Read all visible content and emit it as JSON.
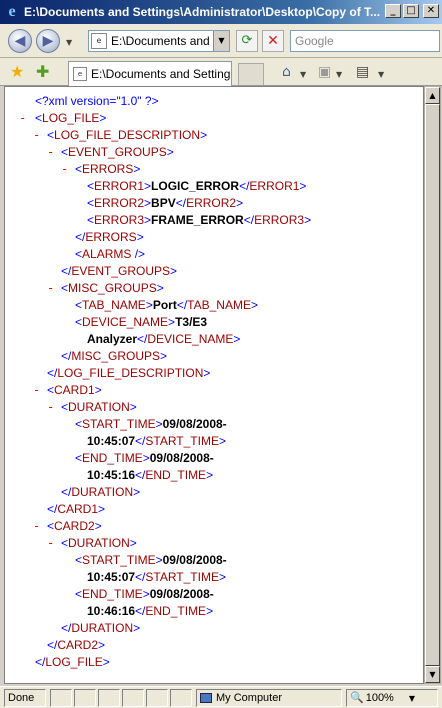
{
  "window": {
    "title": "E:\\Documents and Settings\\Administrator\\Desktop\\Copy of T...",
    "minimize_glyph": "_",
    "maximize_glyph": "□",
    "close_glyph": "✕"
  },
  "address_bar": {
    "url": "E:\\Documents and Set",
    "search_placeholder": "Google",
    "back_glyph": "◀",
    "forward_glyph": "▶",
    "refresh_glyph": "⟳",
    "stop_glyph": "✕"
  },
  "tabs": [
    {
      "label": "E:\\Documents and Setting..."
    }
  ],
  "toolbar": {
    "favorites_glyph": "★",
    "add_favorite_glyph": "✚",
    "home_glyph": "⌂",
    "feeds_glyph": "▣",
    "print_glyph": "▤"
  },
  "xml": {
    "declaration": "<?xml version=\"1.0\" ?>",
    "log_file": "LOG_FILE",
    "log_file_description": "LOG_FILE_DESCRIPTION",
    "event_groups": "EVENT_GROUPS",
    "errors": "ERRORS",
    "error1_tag": "ERROR1",
    "error1_val": "LOGIC_ERROR",
    "error2_tag": "ERROR2",
    "error2_val": "BPV",
    "error3_tag": "ERROR3",
    "error3_val": "FRAME_ERROR",
    "alarms": "ALARMS",
    "misc_groups": "MISC_GROUPS",
    "tab_name_tag": "TAB_NAME",
    "tab_name_val": "Port",
    "device_name_tag": "DEVICE_NAME",
    "device_name_val_1": "T3/E3",
    "device_name_val_2": "Analyzer",
    "card1": "CARD1",
    "card2": "CARD2",
    "duration": "DURATION",
    "start_time_tag": "START_TIME",
    "end_time_tag": "END_TIME",
    "card1_start_date": "09/08/2008-",
    "card1_start_time": "10:45:07",
    "card1_end_date": "09/08/2008-",
    "card1_end_time": "10:45:16",
    "card2_start_date": "09/08/2008-",
    "card2_start_time": "10:45:07",
    "card2_end_date": "09/08/2008-",
    "card2_end_time": "10:46:16",
    "minus": "-"
  },
  "status": {
    "done": "Done",
    "zone": "My Computer",
    "zoom": "100%"
  }
}
